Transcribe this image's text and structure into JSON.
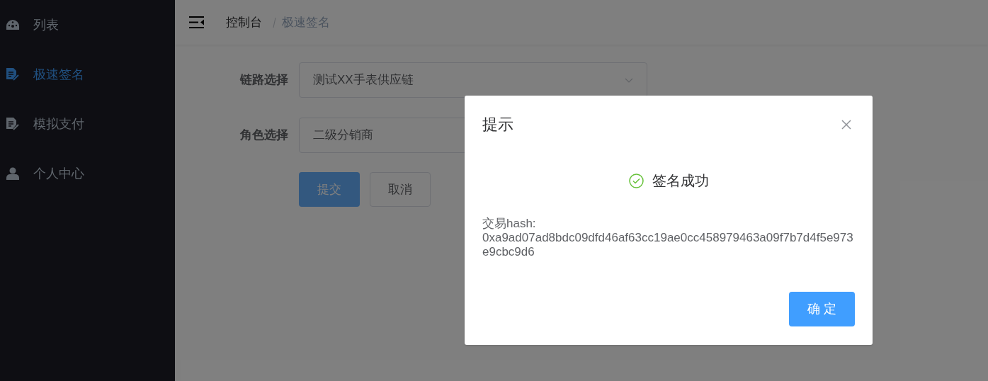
{
  "sidebar": {
    "items": [
      {
        "label": "列表",
        "selected": false
      },
      {
        "label": "极速签名",
        "selected": true
      },
      {
        "label": "模拟支付",
        "selected": false
      },
      {
        "label": "个人中心",
        "selected": false
      }
    ]
  },
  "breadcrumb": [
    {
      "label": "控制台",
      "current": false
    },
    {
      "label": "极速签名",
      "current": true
    }
  ],
  "form": {
    "fields": [
      {
        "label": "链路选择",
        "value": "测试XX手表供应链"
      },
      {
        "label": "角色选择",
        "value": "二级分销商"
      }
    ],
    "buttons": [
      {
        "label": "提交",
        "kind": "primary"
      },
      {
        "label": "取消",
        "kind": "default"
      }
    ]
  },
  "dialog": {
    "title": "提示",
    "message": "签名成功",
    "hash_label": "交易hash:",
    "hash": "0xa9ad07ad8bdc09dfd46af63cc19ae0cc458979463a09f7b7d4f5e973e9cbc9d6",
    "confirm": "确 定"
  }
}
